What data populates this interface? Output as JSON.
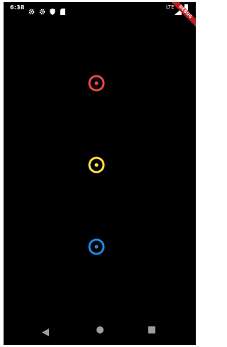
{
  "status_bar": {
    "time": "6:38",
    "network": "LTE",
    "icons": [
      "settings-icon",
      "settings-icon",
      "shield-icon",
      "sd-card-icon",
      "signal-icon",
      "battery-icon"
    ]
  },
  "debug_banner": {
    "label": "DEBUG",
    "color": "#b71c1c"
  },
  "targets": [
    {
      "name": "red-ring-icon",
      "color": "#ef4444"
    },
    {
      "name": "yellow-ring-icon",
      "color": "#fde047"
    },
    {
      "name": "blue-ring-icon",
      "color": "#1e88e5"
    }
  ],
  "nav_bar": {
    "icons": [
      "back-icon",
      "home-icon",
      "recents-icon"
    ],
    "color": "#9e9e9e"
  },
  "colors": {
    "background": "#000000",
    "frame": "#ffffff"
  }
}
